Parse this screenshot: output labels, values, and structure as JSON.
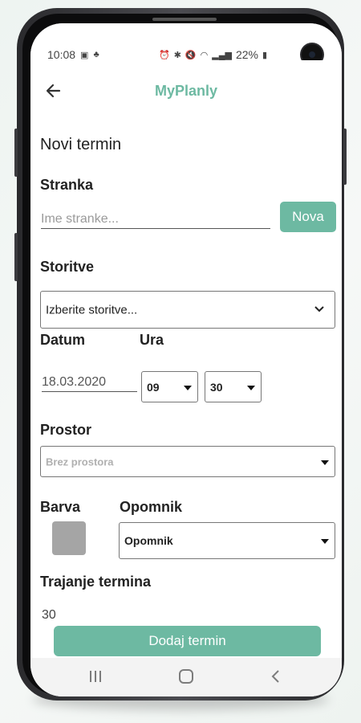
{
  "status_bar": {
    "time": "10:08",
    "battery": "22%"
  },
  "app": {
    "title": "MyPlanly"
  },
  "form": {
    "heading": "Novi termin",
    "client": {
      "label": "Stranka",
      "placeholder": "Ime stranke...",
      "new_button": "Nova"
    },
    "services": {
      "label": "Storitve",
      "placeholder": "Izberite storitve..."
    },
    "date": {
      "label": "Datum",
      "value": "18.03.2020"
    },
    "time": {
      "label": "Ura",
      "hour": "09",
      "minute": "30"
    },
    "room": {
      "label": "Prostor",
      "placeholder": "Brez prostora"
    },
    "color": {
      "label": "Barva",
      "value": "#a5a5a5"
    },
    "reminder": {
      "label": "Opomnik",
      "value": "Opomnik"
    },
    "duration": {
      "label": "Trajanje termina",
      "value": "30"
    },
    "submit": "Dodaj termin"
  },
  "colors": {
    "accent": "#6db9a2"
  },
  "icons": {
    "back": "back-arrow-icon",
    "nav_recent": "recent-apps-icon",
    "nav_home": "home-icon",
    "nav_back": "back-icon"
  }
}
